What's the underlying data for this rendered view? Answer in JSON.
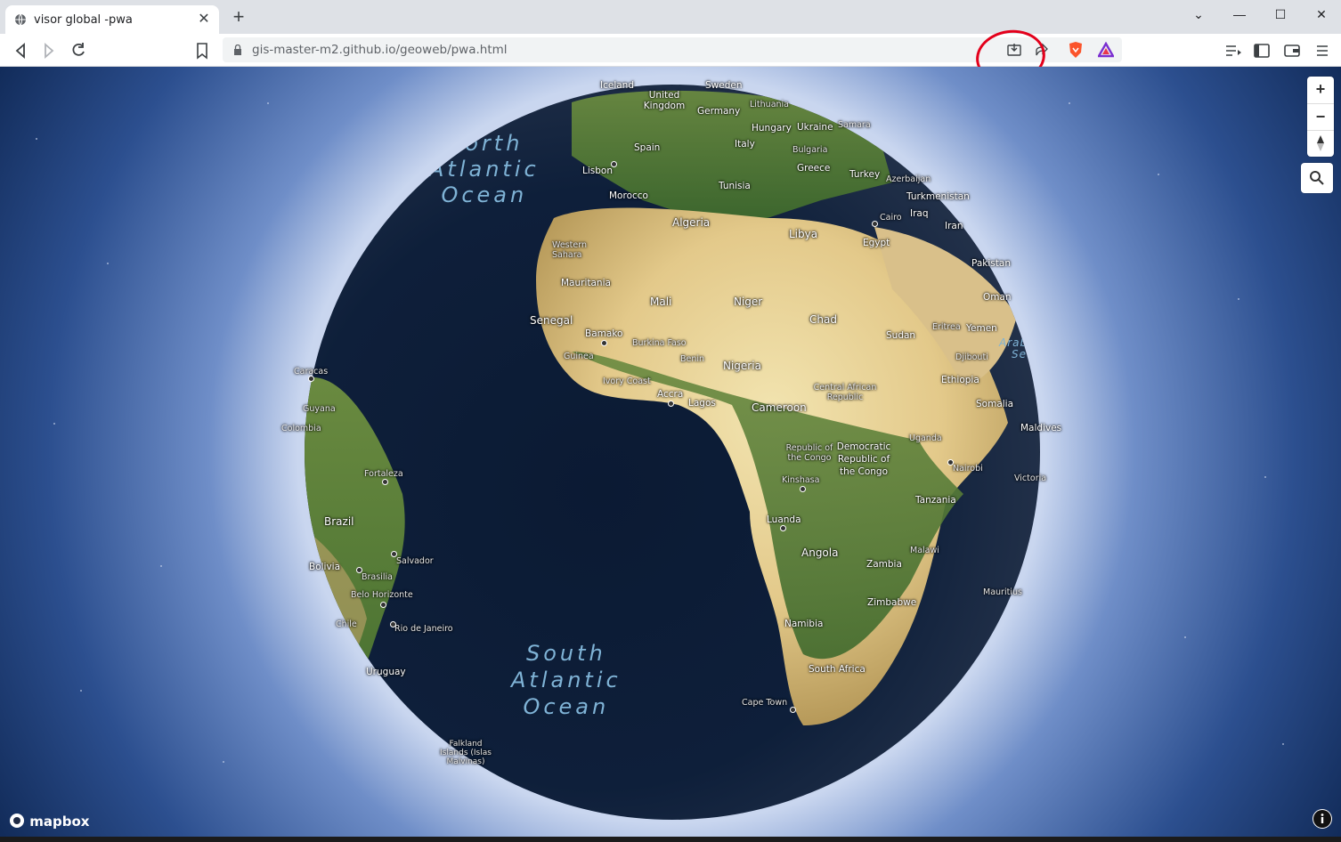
{
  "browser": {
    "tab_title": "visor global -pwa",
    "url": "gis-master-m2.github.io/geoweb/pwa.html",
    "window_controls": [
      "chevron-down",
      "minimize",
      "maximize",
      "close"
    ]
  },
  "map": {
    "attribution_logo": "mapbox",
    "controls": [
      "zoom-in",
      "zoom-out",
      "reset-north",
      "search"
    ],
    "ocean_labels": {
      "north_atlantic": [
        "North",
        "Atlantic",
        "Ocean"
      ],
      "south_atlantic": [
        "South",
        "Atlantic",
        "Ocean"
      ],
      "arabian_sea": [
        "Arabian",
        "Sea"
      ]
    },
    "places": [
      "Iceland",
      "United Kingdom",
      "Sweden",
      "Germany",
      "Lithuania",
      "Hungary",
      "Ukraine",
      "Samara",
      "Italy",
      "Bulgaria",
      "Spain",
      "Lisbon",
      "Greece",
      "Turkey",
      "Azerbaijan",
      "Turkmenistan",
      "Morocco",
      "Tunisia",
      "Cairo",
      "Iraq",
      "Algeria",
      "Libya",
      "Egypt",
      "Iran",
      "Western Sahara",
      "Pakistan",
      "Mauritania",
      "Mali",
      "Niger",
      "Chad",
      "Oman",
      "Senegal",
      "Bamako",
      "Burkina Faso",
      "Sudan",
      "Eritrea",
      "Yemen",
      "Guinea",
      "Benin",
      "Nigeria",
      "Djibouti",
      "Caracas",
      "Ivory Coast",
      "Ethiopia",
      "Accra",
      "Lagos",
      "Central African Republic",
      "Somalia",
      "Guyana",
      "Cameroon",
      "Colombia",
      "Maldives",
      "Uganda",
      "Republic of the Congo",
      "Democratic Republic of the Congo",
      "Nairobi",
      "Fortaleza",
      "Kinshasa",
      "Victoria",
      "Tanzania",
      "Brazil",
      "Luanda",
      "Salvador",
      "Bolivia",
      "Brasilia",
      "Angola",
      "Zambia",
      "Malawi",
      "Belo Horizonte",
      "Mauritius",
      "Zimbabwe",
      "Chile",
      "Rio de Janeiro",
      "Namibia",
      "Uruguay",
      "South Africa",
      "Cape Town",
      "Falkland Islands (Islas Malvinas)"
    ]
  }
}
